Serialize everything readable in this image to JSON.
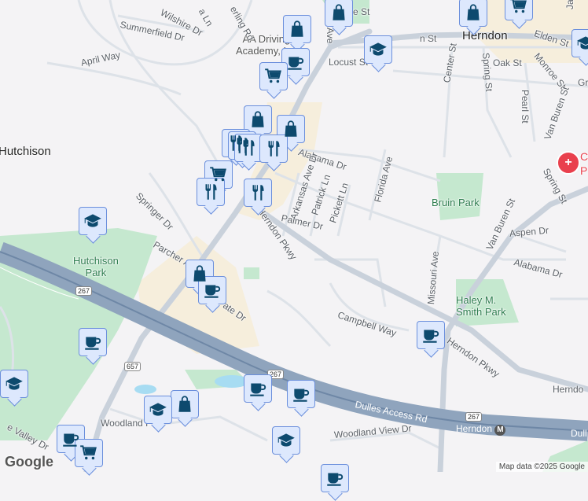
{
  "map": {
    "labels": {
      "herndon": "Herndon",
      "hutchison": "Hutchison",
      "hutchison_park": "Hutchison\nPark",
      "bruin_park": "Bruin Park",
      "haley_park": "Haley M.\nSmith Park",
      "aa_driving": "AA Driving\nAcademy, Inc",
      "hospital_partial": "C\nP",
      "streets": {
        "wilshire": "Wilshire Dr",
        "summerfield": "Summerfield Dr",
        "april": "April Way",
        "sterling": "erling Rd",
        "ave_top": "Ave",
        "grace": "e St",
        "elden": "Elden St",
        "vine": "n St",
        "locust": "Locust St",
        "oak": "Oak St",
        "center": "Center St",
        "spring": "Spring St",
        "monroe": "Monroe St",
        "jackson": "Jackson",
        "pearl": "Pearl St",
        "gr": "Gr",
        "van_buren": "Van Buren St",
        "van_buren2": "Van Buren St",
        "spring2": "Spring St",
        "alabama_top": "Alabama Dr",
        "arkansas": "Arkansas Ave Dr",
        "patrick": "Patrick Ln",
        "pickett": "Pickett Ln",
        "florida": "Florida Ave",
        "palmer": "Palmer Dr",
        "herndon_pkwy": "Herndon Pkwy",
        "herndon_pkwy2": "Herndon Pkwy",
        "herndon_pkwy3": "Herndo",
        "springer": "Springer Dr",
        "parcher": "Parcher Av",
        "ate": "ate Dr",
        "aspen": "Aspen Dr",
        "alabama2": "Alabama Dr",
        "missouri": "Missouri Ave",
        "campbell": "Campbell Way",
        "dulles": "Dulles Access Rd",
        "woodland_park": "Woodland Pa",
        "woodland_view": "Woodland View Dr",
        "valley": "e Valley Dr",
        "a_ln": "a Ln",
        "herndon_metro": "Herndon",
        "dulles2": "Dull"
      },
      "shields": {
        "r267a": "267",
        "r267b": "267",
        "r267c": "267",
        "r657": "657"
      }
    },
    "markers": [
      "shopping-bag",
      "shopping-bag",
      "coffee-cup",
      "shopping-cart",
      "graduation-cap",
      "shopping-bag",
      "shopping-cart",
      "graduation-cap",
      "shopping-bag",
      "shopping-bag",
      "restaurant",
      "restaurant",
      "restaurant",
      "restaurant",
      "shopping-cart",
      "restaurant",
      "restaurant",
      "graduation-cap",
      "shopping-bag",
      "coffee-cup",
      "coffee-cup",
      "coffee-cup",
      "graduation-cap",
      "coffee-cup",
      "coffee-cup",
      "shopping-bag",
      "graduation-cap",
      "coffee-cup",
      "shopping-cart",
      "graduation-cap",
      "coffee-cup"
    ],
    "colors": {
      "marker_fill": "#dde8fd",
      "marker_border": "#6b8fdc",
      "icon": "#0d4a6e",
      "park": "#c5e8cf",
      "commercial": "#f6eedc",
      "highway": "#8fa4bd",
      "hospital": "#e9404d"
    },
    "google_logo": "Google",
    "attribution": "Map data ©2025 Google",
    "metro_icon": "M"
  }
}
